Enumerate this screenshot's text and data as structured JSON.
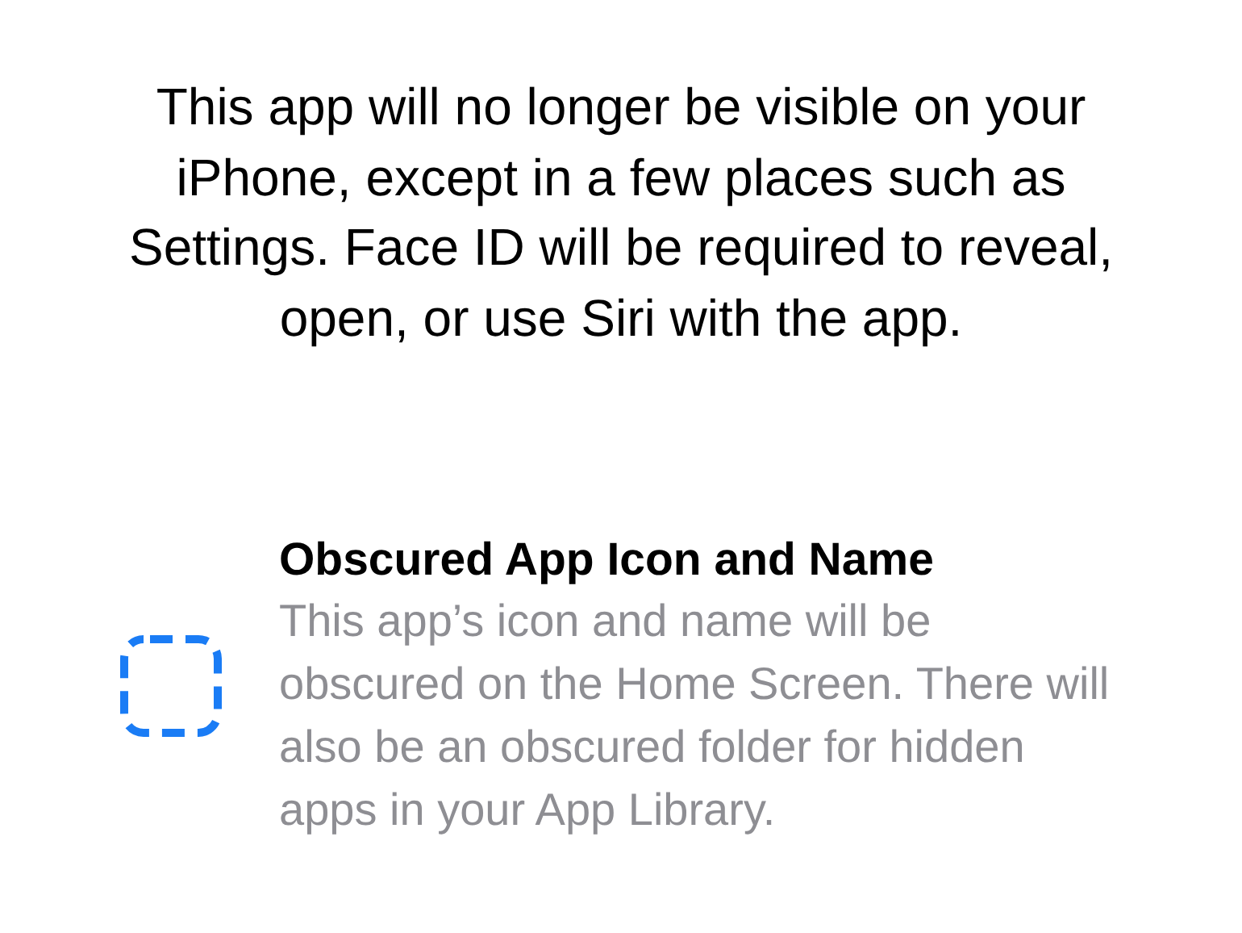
{
  "intro": "This app will no longer be visible on your iPhone, except in a few places such as Settings. Face ID will be required to reveal, open, or use Siri with the app.",
  "features": [
    {
      "kind": "obscured",
      "title": "Obscured App Icon and Name",
      "description": "This app’s icon and name will be obscured on the Home Screen. There will also be an obscured folder for hidden apps in your App Library."
    }
  ]
}
